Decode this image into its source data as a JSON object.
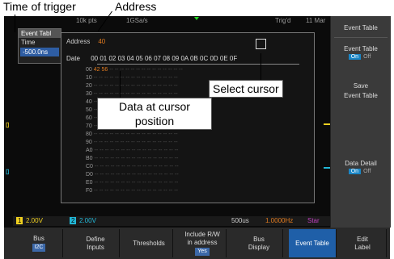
{
  "callouts": {
    "time_of_trigger": "Time of trigger",
    "address": "Address",
    "data_at_cursor_line1": "Data at cursor",
    "data_at_cursor_line2": "position",
    "select_cursor": "Select cursor"
  },
  "topbar": {
    "rate": "10k pts",
    "sample": "1GSa/s",
    "trig_status": "Trig'd",
    "date": "11 Mar"
  },
  "event_table_panel": {
    "title": "Event Tabl",
    "column": "Time",
    "row_value": "-500.0ns"
  },
  "detail": {
    "address_label": "Address",
    "address_value": "40",
    "date_label": "Date",
    "columns": [
      "00",
      "01",
      "02",
      "03",
      "04",
      "05",
      "06",
      "07",
      "08",
      "09",
      "0A",
      "0B",
      "0C",
      "0D",
      "0E",
      "0F"
    ],
    "rows": [
      "00",
      "10",
      "20",
      "30",
      "40",
      "50",
      "60",
      "70",
      "80",
      "90",
      "A0",
      "B0",
      "C0",
      "D0",
      "E0",
      "F0"
    ],
    "data_row0": [
      "42",
      "56"
    ],
    "empty_cell": "--"
  },
  "channel_markers": {
    "ch1": "1",
    "ch2": "2"
  },
  "right_panel": {
    "title": "Event Table",
    "event_table": "Event Table",
    "event_table_on": "On",
    "event_table_off": "Off",
    "save": "Save",
    "save_sub": "Event Table",
    "data_detail": "Data Detail",
    "data_detail_on": "On",
    "data_detail_off": "Off"
  },
  "statusbar": {
    "ch1": "1",
    "ch1_scale": "2.00V",
    "ch2": "2",
    "ch2_scale": "2.00V",
    "timebase": "500us",
    "freq": "1.0000Hz",
    "stat": "Star"
  },
  "softkeys": {
    "bus": "Bus",
    "bus_value": "I2C",
    "define_inputs_1": "Define",
    "define_inputs_2": "Inputs",
    "thresholds": "Thresholds",
    "include_rw_1": "Include R/W",
    "include_rw_2": "in address",
    "include_rw_value": "Yes",
    "bus_display_1": "Bus",
    "bus_display_2": "Display",
    "event_table": "Event Table",
    "edit_label_1": "Edit",
    "edit_label_2": "Label"
  },
  "colors": {
    "accent_orange": "#e07a1f",
    "accent_blue": "#1f5fa8",
    "ch1_yellow": "#f0d020",
    "ch2_cyan": "#22b8d8",
    "bus_magenta": "#c040c0"
  }
}
